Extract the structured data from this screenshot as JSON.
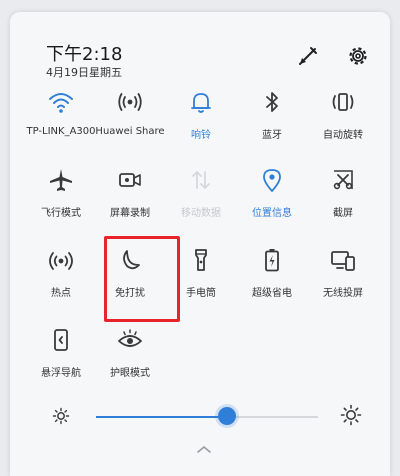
{
  "header": {
    "time": "下午2:18",
    "date": "4月19日星期五"
  },
  "tiles": [
    {
      "name": "wifi",
      "label": "TP-LINK_A300",
      "state": "active",
      "icon": "wifi-icon"
    },
    {
      "name": "huawei-share",
      "label": "Huawei Share",
      "state": "normal",
      "icon": "share-waves-icon"
    },
    {
      "name": "ring",
      "label": "响铃",
      "state": "active",
      "icon": "bell-icon"
    },
    {
      "name": "bluetooth",
      "label": "蓝牙",
      "state": "normal",
      "icon": "bluetooth-icon"
    },
    {
      "name": "auto-rotate",
      "label": "自动旋转",
      "state": "normal",
      "icon": "rotate-icon"
    },
    {
      "name": "airplane",
      "label": "飞行模式",
      "state": "normal",
      "icon": "airplane-icon"
    },
    {
      "name": "screen-record",
      "label": "屏幕录制",
      "state": "normal",
      "icon": "record-icon"
    },
    {
      "name": "mobile-data",
      "label": "移动数据",
      "state": "disabled",
      "icon": "mobile-data-icon"
    },
    {
      "name": "location",
      "label": "位置信息",
      "state": "active",
      "icon": "location-icon"
    },
    {
      "name": "screenshot",
      "label": "截屏",
      "state": "normal",
      "icon": "scissors-icon"
    },
    {
      "name": "hotspot",
      "label": "热点",
      "state": "normal",
      "icon": "hotspot-icon"
    },
    {
      "name": "do-not-disturb",
      "label": "免打扰",
      "state": "normal",
      "icon": "moon-icon"
    },
    {
      "name": "flashlight",
      "label": "手电筒",
      "state": "normal",
      "icon": "flashlight-icon"
    },
    {
      "name": "power-saver",
      "label": "超级省电",
      "state": "normal",
      "icon": "battery-icon"
    },
    {
      "name": "wireless-projection",
      "label": "无线投屏",
      "state": "normal",
      "icon": "projection-icon"
    },
    {
      "name": "floating-nav",
      "label": "悬浮导航",
      "state": "normal",
      "icon": "floating-nav-icon"
    },
    {
      "name": "eye-comfort",
      "label": "护眼模式",
      "state": "normal",
      "icon": "eye-icon"
    }
  ],
  "brightness": {
    "level": 0.59
  },
  "colors": {
    "accent": "#2f7fd8",
    "highlight": "#e8232a",
    "icon": "#3a3a3a",
    "disabled": "#c6c8cc"
  }
}
